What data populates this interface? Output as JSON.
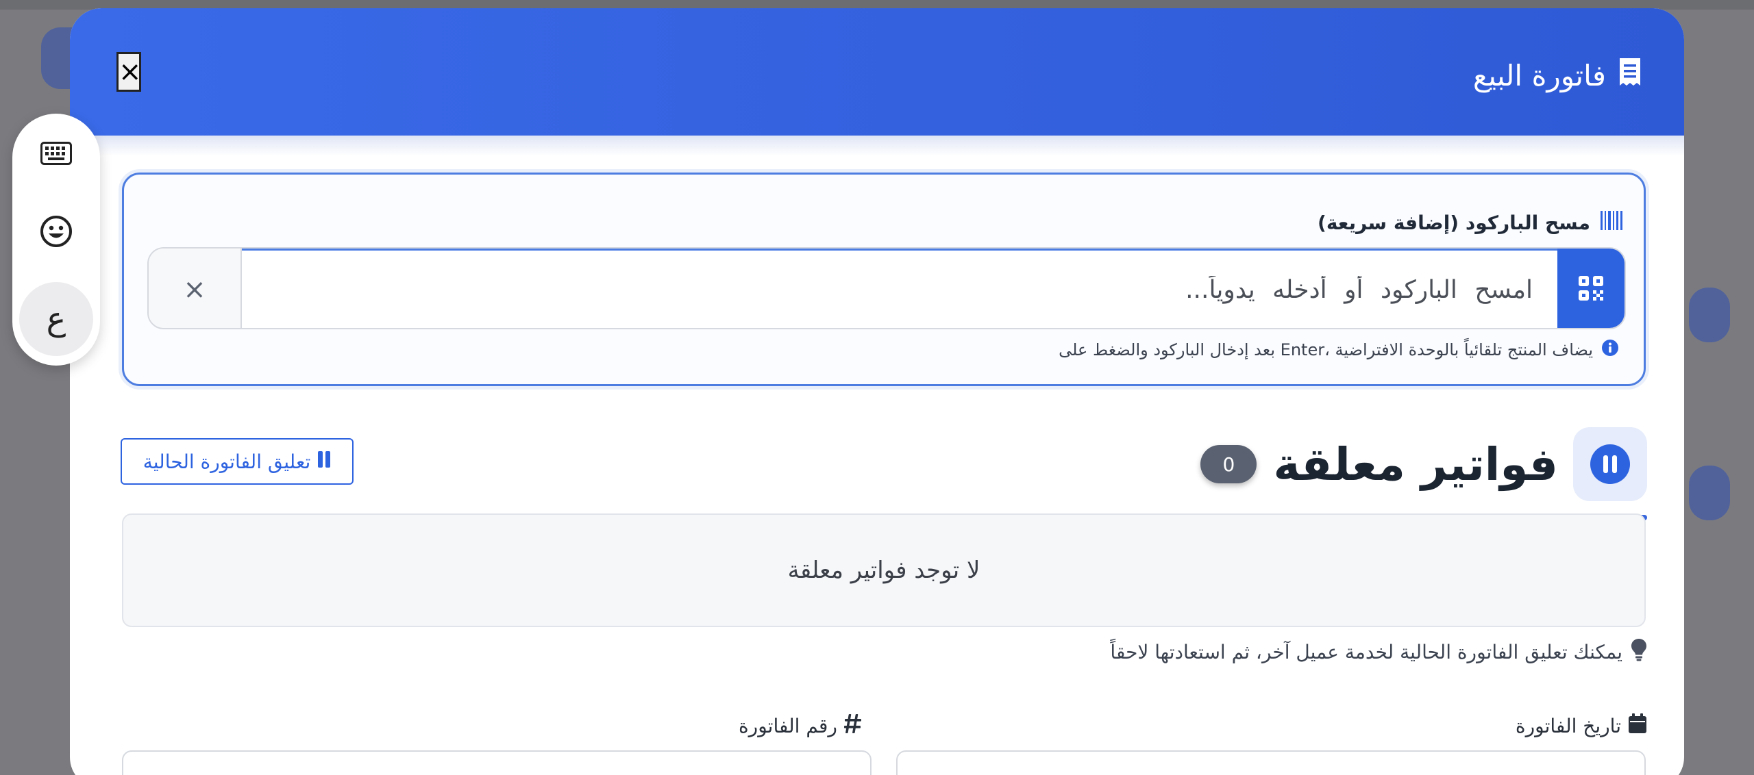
{
  "modal": {
    "title": "فاتورة البيع",
    "close_label": "×"
  },
  "barcode": {
    "label": "مسح الباركود (إضافة سريعة)",
    "placeholder": "امسح الباركود أو أدخله يدوياً...",
    "clear_label": "×",
    "hint": "بعد إدخال الباركود والضغط على Enter، يضاف المنتج تلقائياً بالوحدة الافتراضية"
  },
  "suspended": {
    "title": "فواتير معلقة",
    "count": "0",
    "suspend_button_label": "تعليق الفاتورة الحالية",
    "empty_message": "لا توجد فواتير معلقة",
    "tip": "يمكنك تعليق الفاتورة الحالية لخدمة عميل آخر، ثم استعادتها لاحقاً"
  },
  "fields": {
    "date_label": "تاريخ الفاتورة",
    "number_label": "رقم الفاتورة"
  },
  "side_toolbar": {
    "arabic_label": "ع"
  },
  "colors": {
    "primary": "#2e63e0",
    "header_gradient_start": "#3a6ae8",
    "badge": "#5a6170"
  }
}
